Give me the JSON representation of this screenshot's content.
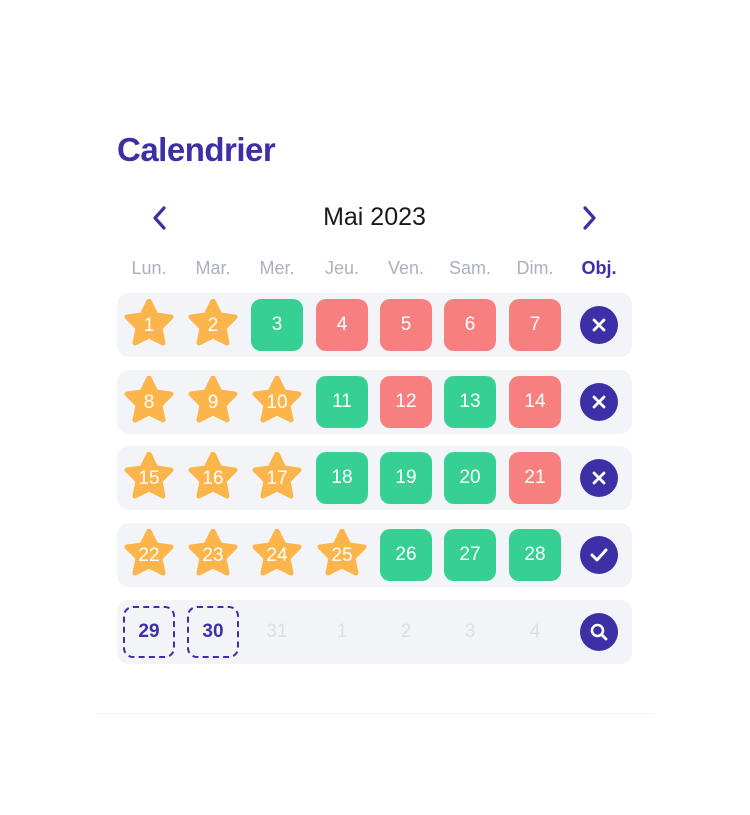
{
  "calendar": {
    "title": "Calendrier",
    "month_label": "Mai 2023",
    "prev_icon": "chevron-left-icon",
    "next_icon": "chevron-right-icon",
    "weekdays": [
      "Lun.",
      "Mar.",
      "Mer.",
      "Jeu.",
      "Ven.",
      "Sam.",
      "Dim."
    ],
    "objective_label": "Obj.",
    "colors": {
      "accent": "#3d2fa6",
      "star": "#fbb54a",
      "success": "#36d192",
      "fail": "#f77f7f",
      "row_bg": "#f3f4f8",
      "muted": "#aab0bf",
      "faded": "#dcdee6"
    },
    "weeks": [
      {
        "days": [
          {
            "label": "1",
            "state": "star"
          },
          {
            "label": "2",
            "state": "star"
          },
          {
            "label": "3",
            "state": "green"
          },
          {
            "label": "4",
            "state": "red"
          },
          {
            "label": "5",
            "state": "red"
          },
          {
            "label": "6",
            "state": "red"
          },
          {
            "label": "7",
            "state": "red"
          }
        ],
        "status": "cross-icon"
      },
      {
        "days": [
          {
            "label": "8",
            "state": "star"
          },
          {
            "label": "9",
            "state": "star"
          },
          {
            "label": "10",
            "state": "star"
          },
          {
            "label": "11",
            "state": "green"
          },
          {
            "label": "12",
            "state": "red"
          },
          {
            "label": "13",
            "state": "green"
          },
          {
            "label": "14",
            "state": "red"
          }
        ],
        "status": "cross-icon"
      },
      {
        "days": [
          {
            "label": "15",
            "state": "star"
          },
          {
            "label": "16",
            "state": "star"
          },
          {
            "label": "17",
            "state": "star"
          },
          {
            "label": "18",
            "state": "green"
          },
          {
            "label": "19",
            "state": "green"
          },
          {
            "label": "20",
            "state": "green"
          },
          {
            "label": "21",
            "state": "red"
          }
        ],
        "status": "cross-icon"
      },
      {
        "days": [
          {
            "label": "22",
            "state": "star"
          },
          {
            "label": "23",
            "state": "star"
          },
          {
            "label": "24",
            "state": "star"
          },
          {
            "label": "25",
            "state": "star"
          },
          {
            "label": "26",
            "state": "green"
          },
          {
            "label": "27",
            "state": "green"
          },
          {
            "label": "28",
            "state": "green"
          }
        ],
        "status": "check-icon"
      },
      {
        "days": [
          {
            "label": "29",
            "state": "dashed"
          },
          {
            "label": "30",
            "state": "dashed"
          },
          {
            "label": "31",
            "state": "faded"
          },
          {
            "label": "1",
            "state": "faded"
          },
          {
            "label": "2",
            "state": "faded"
          },
          {
            "label": "3",
            "state": "faded"
          },
          {
            "label": "4",
            "state": "faded"
          }
        ],
        "status": "search-icon"
      }
    ]
  }
}
